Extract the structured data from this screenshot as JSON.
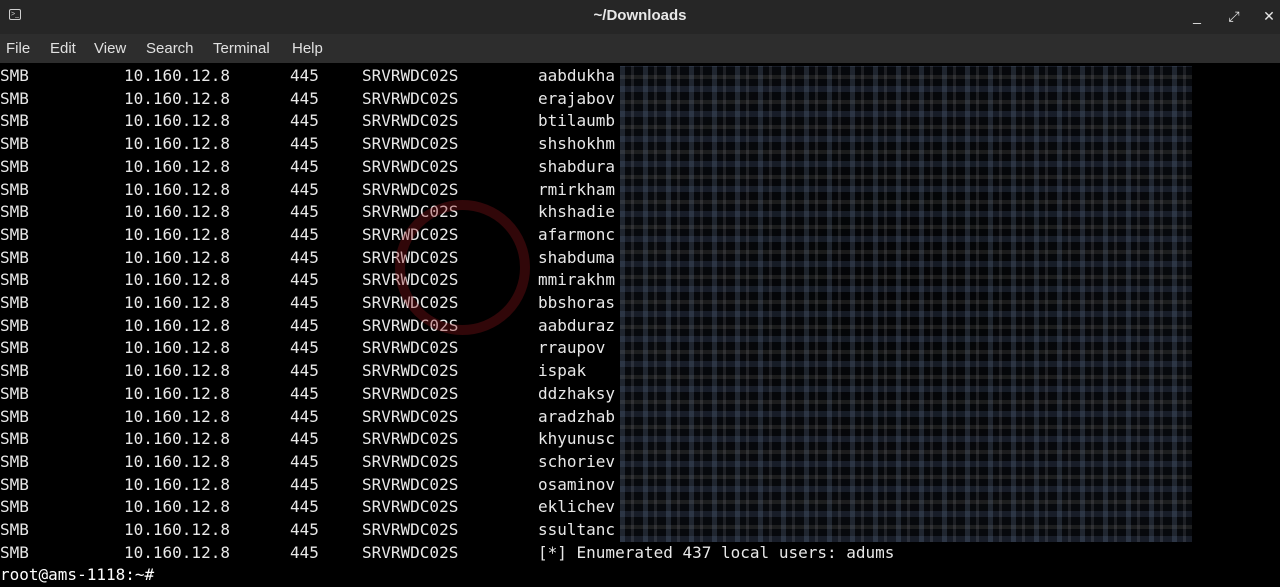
{
  "window": {
    "title": "~/Downloads",
    "minimize": "_",
    "maximize": "⤢",
    "close": "✕"
  },
  "menu": [
    "File",
    "Edit",
    "View",
    "Search",
    "Terminal",
    "Help"
  ],
  "rows": [
    [
      "SMB",
      "10.160.12.8",
      "445",
      "SRVRWDC02S",
      "aabdukha"
    ],
    [
      "SMB",
      "10.160.12.8",
      "445",
      "SRVRWDC02S",
      "erajabov"
    ],
    [
      "SMB",
      "10.160.12.8",
      "445",
      "SRVRWDC02S",
      "btilaumb"
    ],
    [
      "SMB",
      "10.160.12.8",
      "445",
      "SRVRWDC02S",
      "shshokhm"
    ],
    [
      "SMB",
      "10.160.12.8",
      "445",
      "SRVRWDC02S",
      "shabdura"
    ],
    [
      "SMB",
      "10.160.12.8",
      "445",
      "SRVRWDC02S",
      "rmirkham"
    ],
    [
      "SMB",
      "10.160.12.8",
      "445",
      "SRVRWDC02S",
      "khshadie"
    ],
    [
      "SMB",
      "10.160.12.8",
      "445",
      "SRVRWDC02S",
      "afarmonc"
    ],
    [
      "SMB",
      "10.160.12.8",
      "445",
      "SRVRWDC02S",
      "shabduma"
    ],
    [
      "SMB",
      "10.160.12.8",
      "445",
      "SRVRWDC02S",
      "mmirakhm"
    ],
    [
      "SMB",
      "10.160.12.8",
      "445",
      "SRVRWDC02S",
      "bbshoras"
    ],
    [
      "SMB",
      "10.160.12.8",
      "445",
      "SRVRWDC02S",
      "aabduraz"
    ],
    [
      "SMB",
      "10.160.12.8",
      "445",
      "SRVRWDC02S",
      "rraupov"
    ],
    [
      "SMB",
      "10.160.12.8",
      "445",
      "SRVRWDC02S",
      "ispak"
    ],
    [
      "SMB",
      "10.160.12.8",
      "445",
      "SRVRWDC02S",
      "ddzhaksy"
    ],
    [
      "SMB",
      "10.160.12.8",
      "445",
      "SRVRWDC02S",
      "aradzhab"
    ],
    [
      "SMB",
      "10.160.12.8",
      "445",
      "SRVRWDC02S",
      "khyunusc"
    ],
    [
      "SMB",
      "10.160.12.8",
      "445",
      "SRVRWDC02S",
      "schoriev"
    ],
    [
      "SMB",
      "10.160.12.8",
      "445",
      "SRVRWDC02S",
      "osaminov"
    ],
    [
      "SMB",
      "10.160.12.8",
      "445",
      "SRVRWDC02S",
      "eklichev"
    ],
    [
      "SMB",
      "10.160.12.8",
      "445",
      "SRVRWDC02S",
      "ssultanc"
    ],
    [
      "SMB",
      "10.160.12.8",
      "445",
      "SRVRWDC02S",
      "[*] Enumerated 437 local users: adums"
    ]
  ],
  "prompt": "root@ams-1118:~#",
  "colors": {
    "titlebar": "#262626",
    "menubar": "#2d2d2d",
    "terminal_bg": "#000000",
    "terminal_fg": "#e8e8e8"
  }
}
